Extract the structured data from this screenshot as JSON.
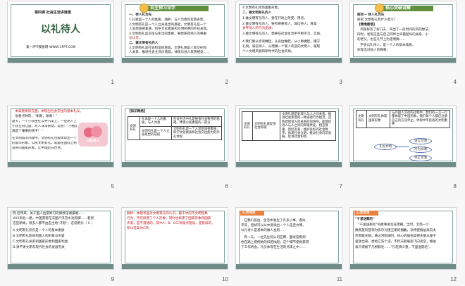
{
  "slides": [
    {
      "number": "1",
      "lesson": "第四课 社会生活讲道德",
      "title": "以礼待人",
      "footer": "第一PPT模板网-WWW.1PPT.COM"
    },
    {
      "number": "2",
      "header": "自主预习导学",
      "lines": [
        "一、待人礼为先",
        "1.礼貌是一个人的素质、涵养、与人为善的友善表现。",
        "2.文明有礼是一个人立身处世的基础，文明有礼是一个",
        "人思想道德素质、科学文化素质和文明修养的外在表现。",
        "3.文明有礼是交往与生活的需要，要想获得他人的尊重",
        "与认可。",
        "二、做文明有礼的人",
        "3.文明有礼是社会和谐的基础，文明礼貌是人际交往和",
        "人关系，推进社会主流价值观，体现与他人友善相处……"
      ]
    },
    {
      "number": "3",
      "lines": [
        "4.文明有礼修饰国家形象，",
        "二、做文明有礼的人",
        "1.做文明有礼的人，要在行动上改变，用语，",
        "2.做文明有礼的人，要有尊重他人，诚信待人，真挚",
        "关怀他人的行为品质。",
        "3.做文明有礼的人，需要在社会生活中不断学习，实践，",
        "4.我们要从点滴做起，从身边做起，从小事做起，遵守",
        "礼貌，诚信待人，从而做一个受人欢迎的文明人，展现",
        "个人文明风貌和新时代的社会风尚。"
      ]
    },
    {
      "number": "4",
      "header": "核心突破讲解",
      "lines": [
        "探究一 待人礼为先",
        "探究 文明有礼有什么意义？",
        "【情境感悟】",
        "   鸡照好热了好几天，突出了一段时间的风的想法，",
        "同时，发现这些与自己同伴之间最起码的关系，小",
        "的老父，也在礼节上约定明确……",
        "   学会以礼待人，是一个人的基本素质，",
        "体现出对他人的尊重。"
      ]
    },
    {
      "number": "5",
      "lines": [
        "   本案重要的方面，体现出社会交往的基本礼仪。",
        "   他者点钟的，\"谢谢，谢谢！\"",
        "   夏天，一个小孩坐在公共汽车上，一位老人上车后，",
        "小孩立刻让座，老人非常感动，说道：\"小朋友，你",
        "真是个懂事的孩子！\"",
        "   在文明城市创建中，文明有礼也能体现出一个城市",
        "的城市形象。公民文明有礼，就能在国际上树立",
        "良好的国家形象，让中国走向世界。"
      ],
      "banner": "以礼待人"
    },
    {
      "number": "6",
      "label": "【知识网络】",
      "rows": [
        [
          "礼体现一个人的素质，与人为善",
          "社会生活中礼是维系社会秩序的基础，体现公民素质的一部分"
        ],
        [
          "文明有礼是一个人立身处世的前提",
          "文明有礼是一个人思想道德素质、科学文化素质和社会交往能力的外在体现"
        ]
      ]
    },
    {
      "number": "7",
      "cells": [
        "文明有礼",
        "文明有礼能促进社会和谐",
        "文明礼貌是处理人与人之间关系、推进社会和谐的一种道德行为规范，是构建和谐人际关系的润滑剂，能够促进人与人之间的和谐共处、相互尊重、团结友爱，维护良好的社会秩序，体现社会文明，推动社会向前发展，促进社会和谐"
      ]
    },
    {
      "number": "8",
      "cells": [
        "文明有礼",
        "文明有礼体现国家形象",
        "与外国人交往的过程中，我们的一言一行都体现了中国形象，我们每个人都应注意自己的言谈举止，体现中华民族的文明素养"
      ],
      "ovals": [
        "礼仪文明",
        "语言文明",
        "行为文明",
        "举止文明"
      ]
    },
    {
      "number": "9",
      "lines": [
        "例 近年来，关于国人出游陋习的频频见诸报端……",
        "XXX到北一路，中国游客在法国卢浮宫水池泡脚……看到",
        "这些新闻，很多人都不由自主地\"汗颜\"，这说明为（ C ）",
        "A.文明有礼仅仅是一个人的基本素质",
        "B.文明有礼影响到国人的形象与声誉",
        "C.文明有礼关系到国家形象和国家利益",
        "D.讲不讲文明与现代社会的发展无关"
      ]
    },
    {
      "number": "10",
      "lines": [
        "解析：本题考查对文明有礼的认识，题干中的不文明现象",
        "行为，不仅损害了个人形象，同时也损害了国家形象和国家",
        "声誉，是不道德的，其中A、B、D三项观点错误，是错误的，",
        "所以答案为C项。"
      ]
    },
    {
      "number": "11",
      "label": "心灵鸡汤",
      "lines": [
        "   在我们身边，生活中发生了许多小事，看似",
        "平常，但却可以从中反映出一个人是否文明，",
        "以礼待人是基本的做人准则……",
        "   有一天，一位先生到公司应聘，面试官看到",
        "他在路上把倒地的扫把扶起，这个细节使他获得",
        "了工作机会。礼仪体现在生活的点滴之中……"
      ]
    },
    {
      "number": "12",
      "label": "心灵鸡汤",
      "lines": [
        "\"千里送鹅毛\"",
        "   \"千里送鹅毛\"的故事发生在唐朝，当时，云南一少",
        "数民族的首领为表示对唐王朝的拥戴，派特使缅伯高向太",
        "宗贡献天鹅。路过沔阳湖时，好心的缅伯高把天鹅从笼子",
        "里放出来，想给它洗个澡，不料天鹅展翅飞向高空，缅伯",
        "高只得拔下几根鹅毛……\"礼轻情义重，千里送鹅毛\"。"
      ]
    }
  ],
  "colors": {
    "accent_red": "#c4151c",
    "header_green": "#5f8f3f",
    "footer_teal": "#6f8d86",
    "soup_orange": "#e8823c"
  }
}
